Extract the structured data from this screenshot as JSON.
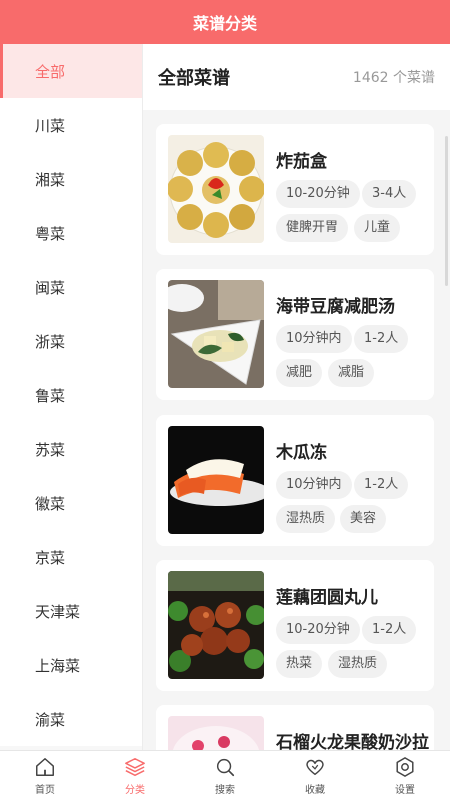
{
  "header": {
    "title": "菜谱分类"
  },
  "sidebar": {
    "items": [
      "全部",
      "川菜",
      "湘菜",
      "粤菜",
      "闽菜",
      "浙菜",
      "鲁菜",
      "苏菜",
      "徽菜",
      "京菜",
      "天津菜",
      "上海菜",
      "渝菜"
    ]
  },
  "main": {
    "title": "全部菜谱",
    "count": "1462 个菜谱",
    "recipes": [
      {
        "name": "炸茄盒",
        "tags": [
          "10-20分钟",
          "3-4人",
          "健脾开胃",
          "儿童"
        ]
      },
      {
        "name": "海带豆腐减肥汤",
        "tags": [
          "10分钟内",
          "1-2人",
          "减肥",
          "减脂"
        ]
      },
      {
        "name": "木瓜冻",
        "tags": [
          "10分钟内",
          "1-2人",
          "湿热质",
          "美容"
        ]
      },
      {
        "name": "莲藕团圆丸儿",
        "tags": [
          "10-20分钟",
          "1-2人",
          "热菜",
          "湿热质"
        ]
      },
      {
        "name": "石榴火龙果酸奶沙拉",
        "tags": []
      }
    ]
  },
  "tabbar": {
    "tabs": [
      {
        "label": "首页",
        "icon": "home-icon"
      },
      {
        "label": "分类",
        "icon": "layers-icon"
      },
      {
        "label": "搜索",
        "icon": "search-icon"
      },
      {
        "label": "收藏",
        "icon": "heart-icon"
      },
      {
        "label": "设置",
        "icon": "settings-icon"
      }
    ]
  },
  "colors": {
    "accent": "#f86b6b",
    "active_bg": "#fde7e7"
  }
}
